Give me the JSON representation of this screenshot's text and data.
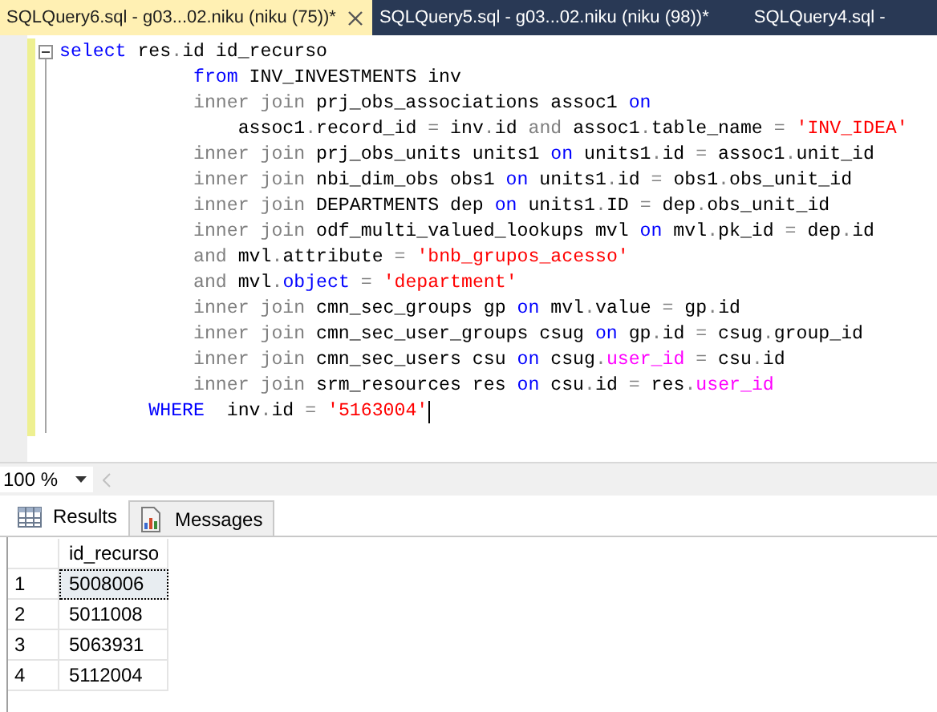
{
  "tabs": [
    {
      "label": "SQLQuery6.sql - g03...02.niku (niku (75))*",
      "selected": true,
      "closable": true
    },
    {
      "label": "SQLQuery5.sql - g03...02.niku (niku (98))*",
      "selected": false,
      "closable": false
    },
    {
      "label": "SQLQuery4.sql -",
      "selected": false,
      "closable": false
    }
  ],
  "editor": {
    "lines": [
      [
        {
          "kind": "kw",
          "text": "select"
        },
        {
          "kind": "id",
          "text": " res"
        },
        {
          "kind": "op",
          "text": "."
        },
        {
          "kind": "id",
          "text": "id id_recurso"
        }
      ],
      [
        {
          "kind": "kw",
          "text": "            from"
        },
        {
          "kind": "id",
          "text": " INV_INVESTMENTS inv"
        }
      ],
      [
        {
          "kind": "op",
          "text": "            inner join"
        },
        {
          "kind": "id",
          "text": " prj_obs_associations assoc1 "
        },
        {
          "kind": "kw",
          "text": "on"
        }
      ],
      [
        {
          "kind": "id",
          "text": "                assoc1"
        },
        {
          "kind": "op",
          "text": "."
        },
        {
          "kind": "id",
          "text": "record_id "
        },
        {
          "kind": "op",
          "text": "="
        },
        {
          "kind": "id",
          "text": " inv"
        },
        {
          "kind": "op",
          "text": "."
        },
        {
          "kind": "id",
          "text": "id "
        },
        {
          "kind": "op",
          "text": "and"
        },
        {
          "kind": "id",
          "text": " assoc1"
        },
        {
          "kind": "op",
          "text": "."
        },
        {
          "kind": "id",
          "text": "table_name "
        },
        {
          "kind": "op",
          "text": "= "
        },
        {
          "kind": "str",
          "text": "'INV_IDEA'"
        }
      ],
      [
        {
          "kind": "op",
          "text": "            inner join"
        },
        {
          "kind": "id",
          "text": " prj_obs_units units1 "
        },
        {
          "kind": "kw",
          "text": "on"
        },
        {
          "kind": "id",
          "text": " units1"
        },
        {
          "kind": "op",
          "text": "."
        },
        {
          "kind": "id",
          "text": "id "
        },
        {
          "kind": "op",
          "text": "="
        },
        {
          "kind": "id",
          "text": " assoc1"
        },
        {
          "kind": "op",
          "text": "."
        },
        {
          "kind": "id",
          "text": "unit_id"
        }
      ],
      [
        {
          "kind": "op",
          "text": "            inner join"
        },
        {
          "kind": "id",
          "text": " nbi_dim_obs obs1 "
        },
        {
          "kind": "kw",
          "text": "on"
        },
        {
          "kind": "id",
          "text": " units1"
        },
        {
          "kind": "op",
          "text": "."
        },
        {
          "kind": "id",
          "text": "id "
        },
        {
          "kind": "op",
          "text": "="
        },
        {
          "kind": "id",
          "text": " obs1"
        },
        {
          "kind": "op",
          "text": "."
        },
        {
          "kind": "id",
          "text": "obs_unit_id"
        }
      ],
      [
        {
          "kind": "op",
          "text": "            inner join"
        },
        {
          "kind": "id",
          "text": " DEPARTMENTS dep "
        },
        {
          "kind": "kw",
          "text": "on"
        },
        {
          "kind": "id",
          "text": " units1"
        },
        {
          "kind": "op",
          "text": "."
        },
        {
          "kind": "id",
          "text": "ID "
        },
        {
          "kind": "op",
          "text": "="
        },
        {
          "kind": "id",
          "text": " dep"
        },
        {
          "kind": "op",
          "text": "."
        },
        {
          "kind": "id",
          "text": "obs_unit_id"
        }
      ],
      [
        {
          "kind": "op",
          "text": "            inner join"
        },
        {
          "kind": "id",
          "text": " odf_multi_valued_lookups mvl "
        },
        {
          "kind": "kw",
          "text": "on"
        },
        {
          "kind": "id",
          "text": " mvl"
        },
        {
          "kind": "op",
          "text": "."
        },
        {
          "kind": "id",
          "text": "pk_id "
        },
        {
          "kind": "op",
          "text": "="
        },
        {
          "kind": "id",
          "text": " dep"
        },
        {
          "kind": "op",
          "text": "."
        },
        {
          "kind": "id",
          "text": "id"
        }
      ],
      [
        {
          "kind": "op",
          "text": "            and"
        },
        {
          "kind": "id",
          "text": " mvl"
        },
        {
          "kind": "op",
          "text": "."
        },
        {
          "kind": "id",
          "text": "attribute "
        },
        {
          "kind": "op",
          "text": "= "
        },
        {
          "kind": "str",
          "text": "'bnb_grupos_acesso'"
        }
      ],
      [
        {
          "kind": "op",
          "text": "            and"
        },
        {
          "kind": "id",
          "text": " mvl"
        },
        {
          "kind": "op",
          "text": "."
        },
        {
          "kind": "kw",
          "text": "object "
        },
        {
          "kind": "op",
          "text": "= "
        },
        {
          "kind": "str",
          "text": "'department'"
        }
      ],
      [
        {
          "kind": "op",
          "text": "            inner join"
        },
        {
          "kind": "id",
          "text": " cmn_sec_groups gp "
        },
        {
          "kind": "kw",
          "text": "on"
        },
        {
          "kind": "id",
          "text": " mvl"
        },
        {
          "kind": "op",
          "text": "."
        },
        {
          "kind": "id",
          "text": "value "
        },
        {
          "kind": "op",
          "text": "="
        },
        {
          "kind": "id",
          "text": " gp"
        },
        {
          "kind": "op",
          "text": "."
        },
        {
          "kind": "id",
          "text": "id"
        }
      ],
      [
        {
          "kind": "op",
          "text": "            inner join"
        },
        {
          "kind": "id",
          "text": " cmn_sec_user_groups csug "
        },
        {
          "kind": "kw",
          "text": "on"
        },
        {
          "kind": "id",
          "text": " gp"
        },
        {
          "kind": "op",
          "text": "."
        },
        {
          "kind": "id",
          "text": "id "
        },
        {
          "kind": "op",
          "text": "="
        },
        {
          "kind": "id",
          "text": " csug"
        },
        {
          "kind": "op",
          "text": "."
        },
        {
          "kind": "id",
          "text": "group_id"
        }
      ],
      [
        {
          "kind": "op",
          "text": "            inner join"
        },
        {
          "kind": "id",
          "text": " cmn_sec_users csu "
        },
        {
          "kind": "kw",
          "text": "on"
        },
        {
          "kind": "id",
          "text": " csug"
        },
        {
          "kind": "op",
          "text": "."
        },
        {
          "kind": "fn",
          "text": "user_id "
        },
        {
          "kind": "op",
          "text": "="
        },
        {
          "kind": "id",
          "text": " csu"
        },
        {
          "kind": "op",
          "text": "."
        },
        {
          "kind": "id",
          "text": "id"
        }
      ],
      [
        {
          "kind": "op",
          "text": "            inner join"
        },
        {
          "kind": "id",
          "text": " srm_resources res "
        },
        {
          "kind": "kw",
          "text": "on"
        },
        {
          "kind": "id",
          "text": " csu"
        },
        {
          "kind": "op",
          "text": "."
        },
        {
          "kind": "id",
          "text": "id "
        },
        {
          "kind": "op",
          "text": "="
        },
        {
          "kind": "id",
          "text": " res"
        },
        {
          "kind": "op",
          "text": "."
        },
        {
          "kind": "fn",
          "text": "user_id"
        }
      ],
      [
        {
          "kind": "kw",
          "text": "        WHERE"
        },
        {
          "kind": "id",
          "text": "  inv"
        },
        {
          "kind": "op",
          "text": "."
        },
        {
          "kind": "id",
          "text": "id "
        },
        {
          "kind": "op",
          "text": "= "
        },
        {
          "kind": "str",
          "text": "'5163004'"
        }
      ]
    ]
  },
  "zoom": {
    "value": "100 %"
  },
  "result_tabs": [
    {
      "label": "Results",
      "selected": true
    },
    {
      "label": "Messages",
      "selected": false
    }
  ],
  "grid": {
    "columns": [
      "id_recurso"
    ],
    "rows": [
      {
        "number": "1",
        "cells": [
          "5008006"
        ],
        "selected": true
      },
      {
        "number": "2",
        "cells": [
          "5011008"
        ],
        "selected": false
      },
      {
        "number": "3",
        "cells": [
          "5063931"
        ],
        "selected": false
      },
      {
        "number": "4",
        "cells": [
          "5112004"
        ],
        "selected": false
      }
    ]
  }
}
